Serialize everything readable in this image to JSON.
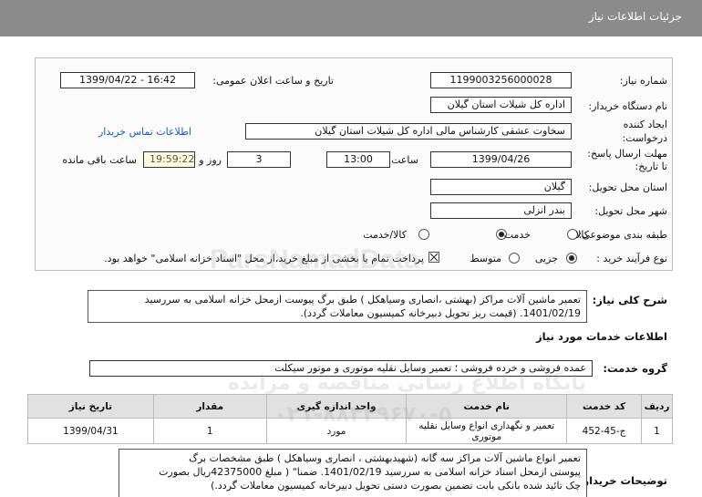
{
  "header": {
    "title": "جزئیات اطلاعات نیاز"
  },
  "need_number": {
    "label": "شماره نیاز:",
    "value": "1199003256000028"
  },
  "announce_datetime": {
    "label": "تاریخ و ساعت اعلان عمومی:",
    "value": "1399/04/22 - 16:42"
  },
  "buyer_org": {
    "label": "نام دستگاه خریدار:",
    "value": "اداره کل شیلات استان گیلان"
  },
  "creator": {
    "label_line1": "ایجاد کننده",
    "label_line2": "درخواست:",
    "value": "سخاوت  عشقی  کارشناس مالی  اداره کل شیلات استان گیلان"
  },
  "contact_link": "اطلاعات تماس خریدار",
  "deadline": {
    "label_line1": "مهلت ارسال پاسخ:",
    "label_line2": "تا تاریخ:",
    "date": "1399/04/26",
    "time_label": "ساعت",
    "time": "13:00",
    "days": "3",
    "days_label": "روز و",
    "remaining": "19:59:22",
    "remaining_label": "ساعت باقی مانده"
  },
  "province": {
    "label": "استان محل تحویل:",
    "value": "گیلان"
  },
  "city": {
    "label": "شهر محل تحویل:",
    "value": "بندر انزلی"
  },
  "category": {
    "label": "طبقه بندی موضوعی:",
    "options": [
      "کالا",
      "خدمت",
      "کالا/خدمت"
    ],
    "selected": "خدمت"
  },
  "process_type": {
    "label": "نوع فرآیند خرید :",
    "options": [
      "جزیی",
      "متوسط"
    ],
    "selected": "جزیی",
    "treasury_note": "پرداخت تمام یا بخشی از مبلغ خرید،از محل \"اسناد خزانه اسلامی\" خواهد بود."
  },
  "summary": {
    "label": "شرح کلی نیاز:",
    "line1": "تعمیر ماشین آلات مراکز (بهشتی ،انصاری وسیاهکل ) طبق برگ پیوست ازمحل خزانه اسلامی به سررسید",
    "line2": "1401/02/19. (قیمت ریز تحویل دبیرخانه کمیسیون معاملات گردد)."
  },
  "services_info_title": "اطلاعات خدمات مورد نیاز",
  "service_group": {
    "label": "گروه خدمت:",
    "value": "عمده فروشی و خرده فروشی ؛ تعمیر وسایل نقلیه موتوری و موتور سیکلت"
  },
  "table": {
    "headers": [
      "ردیف",
      "کد خدمت",
      "نام خدمت",
      "واحد اندازه گیری",
      "مقدار",
      "تاریخ نیاز"
    ],
    "rows": [
      [
        "1",
        "ج-45-452",
        "تعمیر و نگهداری انواع وسایل نقلیه موتوری",
        "مورد",
        "1",
        "1399/04/31"
      ]
    ]
  },
  "buyer_notes": {
    "label": "توضیحات خریدار:",
    "line1": "تعمیر انواع ماشین آلات مراکز سه گانه (شهیدبهشتی ، انصاری وسیاهکل ) طبق مشخصات برگ",
    "line2": "پیوستی ازمحل اسناد خزانه اسلامی به سررسید 1401/02/19. ضمنا\" ( مبلغ 42375000ریال بصورت",
    "line3": "چک تائید شده بانکی بابت تضمین بصورت دستی تحویل دبیرخانه کمیسیون معاملات گردد.)"
  },
  "watermark": {
    "brand": "ParsNamadData",
    "line1": "پایگاه اطلاع رسانی مناقصه و مزایده",
    "line2": "۰۲۱-۸۸۳۴۹۶۷۰-۵"
  }
}
